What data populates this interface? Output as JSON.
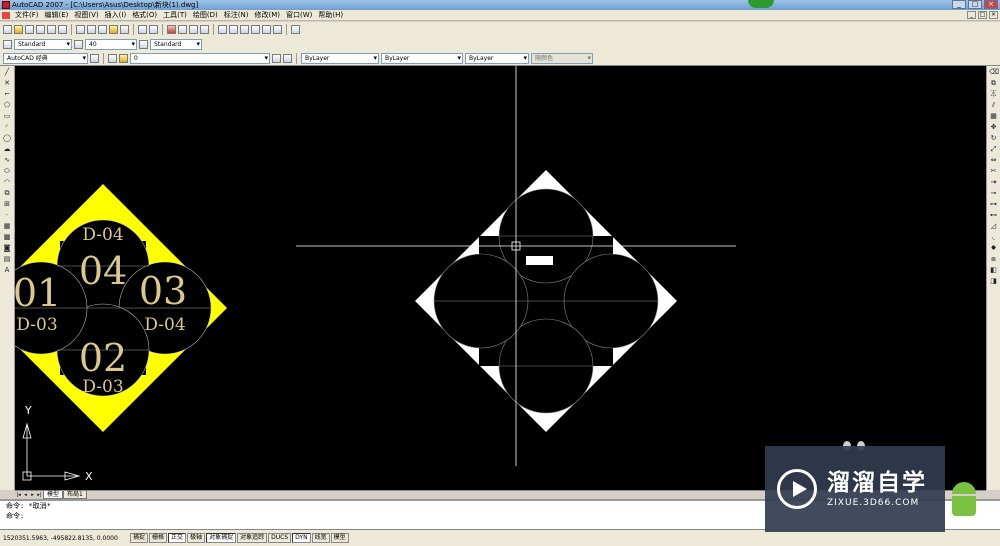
{
  "window": {
    "title": "AutoCAD 2007 - [C:\\Users\\Asus\\Desktop\\新块(1).dwg]"
  },
  "menu": [
    "文件(F)",
    "编辑(E)",
    "视图(V)",
    "插入(I)",
    "格式(O)",
    "工具(T)",
    "绘图(D)",
    "标注(N)",
    "修改(M)",
    "窗口(W)",
    "帮助(H)"
  ],
  "toolbar2": {
    "text_style": "Standard",
    "dim_value": "40",
    "dim_style": "Standard"
  },
  "toolbar3": {
    "workspace": "AutoCAD 经典",
    "layer": "0",
    "color": "ByLayer",
    "linetype": "ByLayer",
    "lineweight": "ByLayer",
    "plotstyle": "随颜色"
  },
  "drawing_left": {
    "labels_small": [
      "D-04",
      "D-03",
      "D-04",
      "D-03"
    ],
    "labels_big": [
      "04",
      "01",
      "03",
      "02"
    ]
  },
  "ucs": {
    "x": "X",
    "y": "Y"
  },
  "layout_tabs": [
    "模型",
    "布局1"
  ],
  "command": {
    "line1": "命令: *取消*",
    "line2": "命令:"
  },
  "status": {
    "coords": "1520351.5963, -495822.8135, 0.0000",
    "buttons": [
      {
        "label": "捕捉",
        "on": false
      },
      {
        "label": "栅格",
        "on": false
      },
      {
        "label": "正交",
        "on": true
      },
      {
        "label": "极轴",
        "on": false
      },
      {
        "label": "对象捕捉",
        "on": true
      },
      {
        "label": "对象追踪",
        "on": false
      },
      {
        "label": "DUCS",
        "on": false
      },
      {
        "label": "DYN",
        "on": true
      },
      {
        "label": "线宽",
        "on": false
      },
      {
        "label": "模型",
        "on": false
      }
    ]
  },
  "watermark": {
    "title": "溜溜自学",
    "url": "ZIXUE.3D66.COM"
  },
  "colors": {
    "canvas": "#000000",
    "yellow_fill": "#ffff00",
    "label_gold": "#d9c98a"
  }
}
